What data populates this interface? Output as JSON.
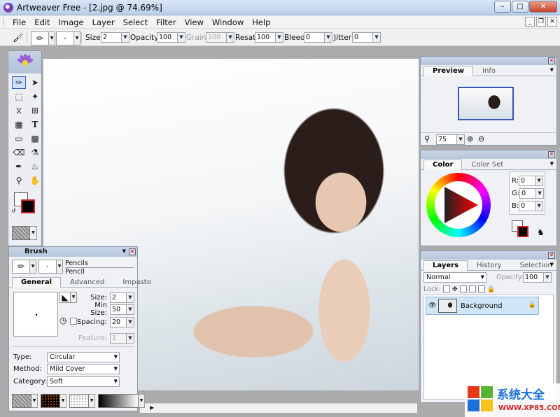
{
  "window": {
    "title": "Artweaver Free - [2.jpg @ 74.69%]"
  },
  "menu": [
    "File",
    "Edit",
    "Image",
    "Layer",
    "Select",
    "Filter",
    "View",
    "Window",
    "Help"
  ],
  "options": {
    "size_label": "Size:",
    "size": "2",
    "opacity_label": "Opacity:",
    "opacity": "100",
    "grain_label": "Grain:",
    "grain": "100",
    "resat_label": "Resat:",
    "resat": "100",
    "bleed_label": "Bleed:",
    "bleed": "0",
    "jitter_label": "Jitter:",
    "jitter": "0"
  },
  "preview": {
    "tabs": [
      "Preview",
      "Info"
    ],
    "zoom": "75"
  },
  "color": {
    "tabs": [
      "Color",
      "Color Set"
    ],
    "r_label": "R:",
    "r": "0",
    "g_label": "G:",
    "g": "0",
    "b_label": "B:",
    "b": "0",
    "foreground": "#000000",
    "background": "#ffffff"
  },
  "layers": {
    "tabs": [
      "Layers",
      "History",
      "Selection"
    ],
    "blend_mode": "Normal",
    "opacity_label": "Opacity:",
    "opacity": "100",
    "lock_label": "Lock:",
    "items": [
      {
        "name": "Background"
      }
    ]
  },
  "brush": {
    "title": "Brush",
    "category_name": "Pencils",
    "variant_name": "Pencil",
    "tabs": [
      "General",
      "Advanced",
      "Impasto"
    ],
    "size_label": "Size:",
    "size": "2",
    "min_size_label": "Min Size:",
    "min_size": "50",
    "spacing_label": "Spacing:",
    "spacing": "20",
    "feature_label": "Feature:",
    "feature": "1",
    "type_label": "Type:",
    "type": "Circular",
    "method_label": "Method:",
    "method": "Mild Cover",
    "category_label": "Category:",
    "category": "Soft"
  },
  "watermark": {
    "text": "系统大全",
    "url": "WWW.XP85.COM"
  }
}
